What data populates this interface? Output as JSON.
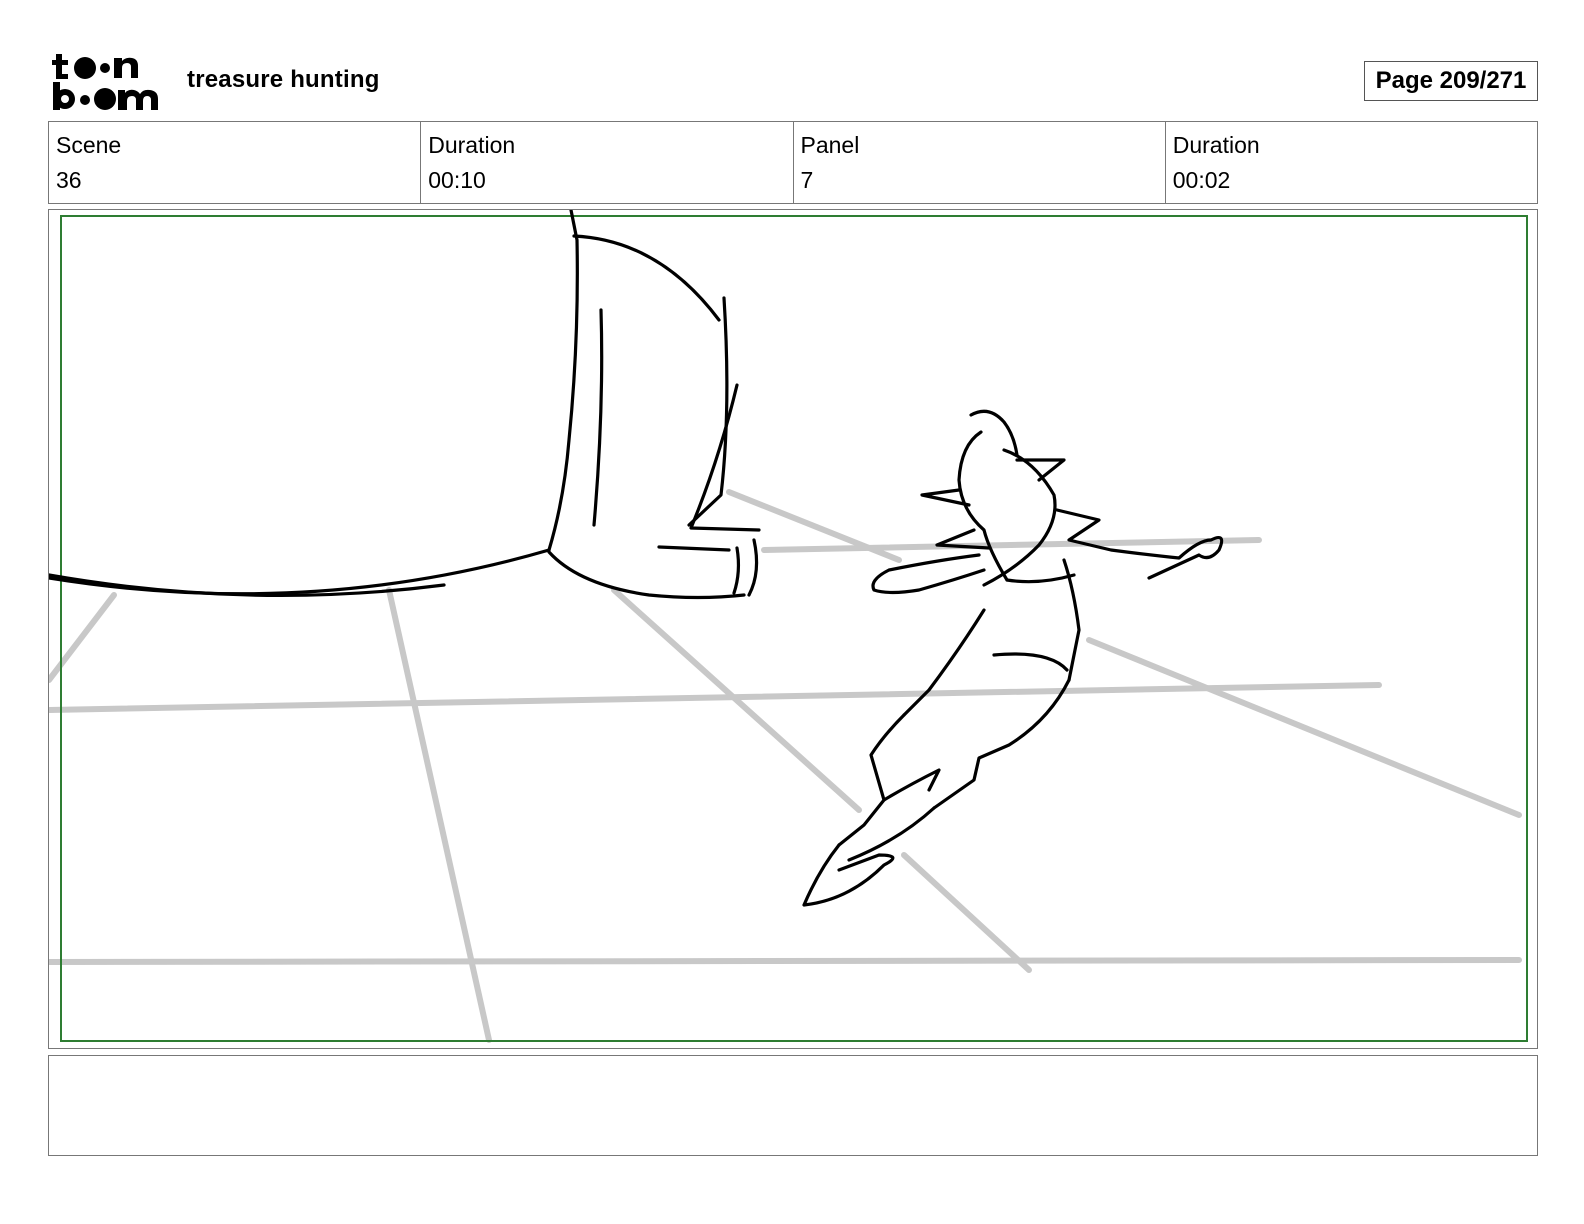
{
  "header": {
    "logo_alt": "toon boom",
    "project_title": "treasure hunting",
    "page_label": "Page 209/271"
  },
  "info": {
    "scene_label": "Scene",
    "scene_value": "36",
    "scene_duration_label": "Duration",
    "scene_duration_value": "00:10",
    "panel_label": "Panel",
    "panel_value": "7",
    "panel_duration_label": "Duration",
    "panel_duration_value": "00:02"
  },
  "panel": {
    "safe_frame_color": "#2e7d32",
    "floor_line_color": "#c8c8c8",
    "sketch_color": "#000000"
  },
  "notes": {
    "text": ""
  }
}
